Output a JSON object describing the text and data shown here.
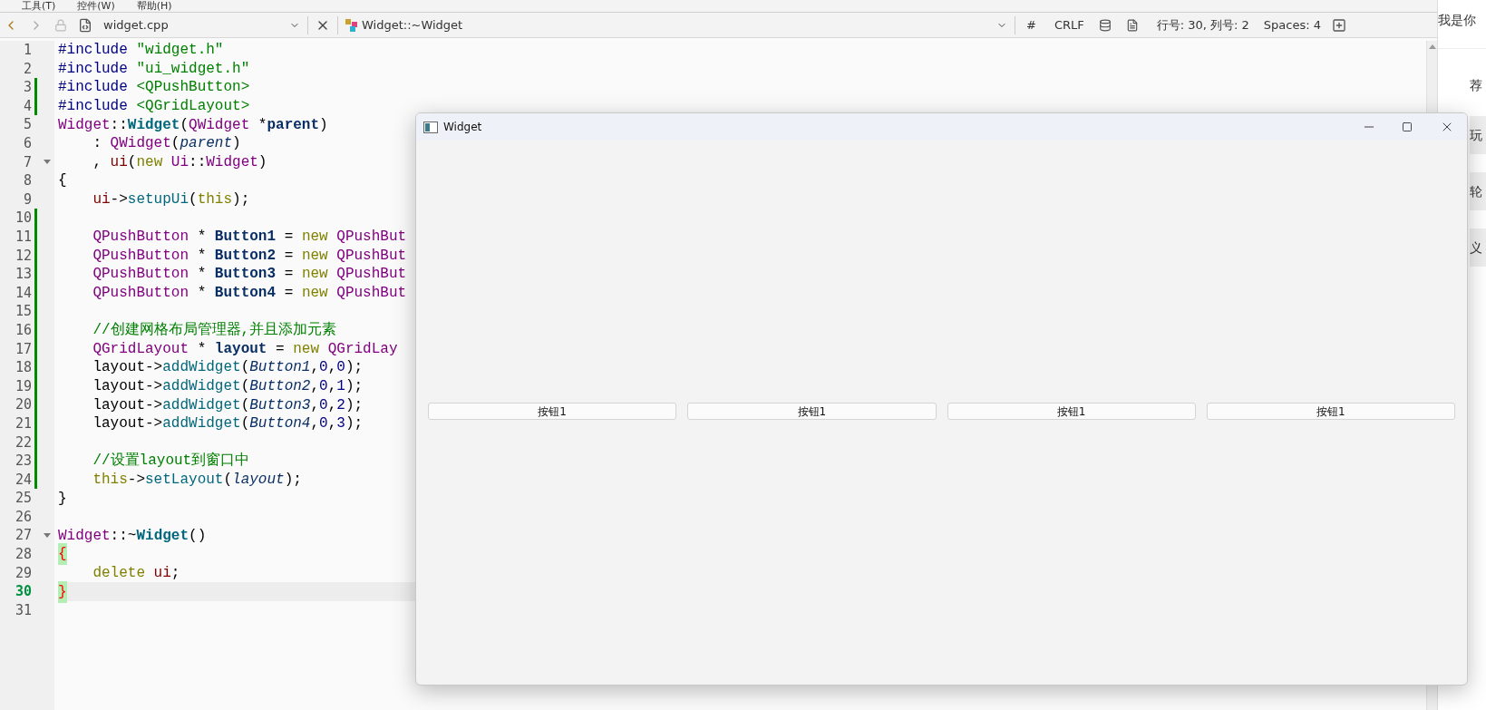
{
  "menu_bar": [
    "工具(T)",
    "控件(W)",
    "帮助(H)"
  ],
  "toolbar": {
    "file_name": "widget.cpp",
    "symbol": "Widget::~Widget",
    "hash": "#",
    "line_ending": "CRLF",
    "position": "行号: 30, 列号: 2",
    "indent": "Spaces: 4"
  },
  "code_lines": [
    {
      "number": "1",
      "changed": false,
      "fold": false,
      "current": false,
      "tokens": [
        {
          "text": "#include ",
          "kind": "preproc"
        },
        {
          "text": "\"widget.h\"",
          "kind": "string"
        }
      ]
    },
    {
      "number": "2",
      "changed": false,
      "fold": false,
      "current": false,
      "tokens": [
        {
          "text": "#include ",
          "kind": "preproc"
        },
        {
          "text": "\"ui_widget.h\"",
          "kind": "string"
        }
      ]
    },
    {
      "number": "3",
      "changed": true,
      "fold": false,
      "current": false,
      "tokens": [
        {
          "text": "#include ",
          "kind": "preproc"
        },
        {
          "text": "<QPushButton>",
          "kind": "string"
        }
      ]
    },
    {
      "number": "4",
      "changed": true,
      "fold": false,
      "current": false,
      "tokens": [
        {
          "text": "#include ",
          "kind": "preproc"
        },
        {
          "text": "<QGridLayout>",
          "kind": "string"
        }
      ]
    },
    {
      "number": "5",
      "changed": false,
      "fold": false,
      "current": false,
      "tokens": [
        {
          "text": "Widget",
          "kind": "type"
        },
        {
          "text": "::",
          "kind": "plain"
        },
        {
          "text": "Widget",
          "kind": "func_def"
        },
        {
          "text": "(",
          "kind": "plain"
        },
        {
          "text": "QWidget",
          "kind": "type"
        },
        {
          "text": " *",
          "kind": "plain"
        },
        {
          "text": "parent",
          "kind": "bold"
        },
        {
          "text": ")",
          "kind": "plain"
        }
      ]
    },
    {
      "number": "6",
      "changed": false,
      "fold": false,
      "current": false,
      "tokens": [
        {
          "text": "    : ",
          "kind": "plain"
        },
        {
          "text": "QWidget",
          "kind": "type"
        },
        {
          "text": "(",
          "kind": "plain"
        },
        {
          "text": "parent",
          "kind": "param"
        },
        {
          "text": ")",
          "kind": "plain"
        }
      ]
    },
    {
      "number": "7",
      "changed": false,
      "fold": true,
      "current": false,
      "tokens": [
        {
          "text": "    , ",
          "kind": "plain"
        },
        {
          "text": "ui",
          "kind": "member"
        },
        {
          "text": "(",
          "kind": "plain"
        },
        {
          "text": "new",
          "kind": "keyword"
        },
        {
          "text": " Ui",
          "kind": "type"
        },
        {
          "text": "::",
          "kind": "plain"
        },
        {
          "text": "Widget",
          "kind": "type"
        },
        {
          "text": ")",
          "kind": "plain"
        }
      ]
    },
    {
      "number": "8",
      "changed": false,
      "fold": false,
      "current": false,
      "tokens": [
        {
          "text": "{",
          "kind": "plain"
        }
      ]
    },
    {
      "number": "9",
      "changed": false,
      "fold": false,
      "current": false,
      "tokens": [
        {
          "text": "    ui",
          "kind": "member"
        },
        {
          "text": "->",
          "kind": "plain"
        },
        {
          "text": "setupUi",
          "kind": "func"
        },
        {
          "text": "(",
          "kind": "plain"
        },
        {
          "text": "this",
          "kind": "keyword"
        },
        {
          "text": ");",
          "kind": "plain"
        }
      ]
    },
    {
      "number": "10",
      "changed": true,
      "fold": false,
      "current": false
    },
    {
      "number": "11",
      "changed": true,
      "fold": false,
      "current": false,
      "tokens": [
        {
          "text": "    QPushButton",
          "kind": "type"
        },
        {
          "text": " * ",
          "kind": "plain"
        },
        {
          "text": "Button1",
          "kind": "bold"
        },
        {
          "text": " = ",
          "kind": "plain"
        },
        {
          "text": "new",
          "kind": "keyword"
        },
        {
          "text": " QPushBut",
          "kind": "type"
        }
      ]
    },
    {
      "number": "12",
      "changed": true,
      "fold": false,
      "current": false,
      "tokens": [
        {
          "text": "    QPushButton",
          "kind": "type"
        },
        {
          "text": " * ",
          "kind": "plain"
        },
        {
          "text": "Button2",
          "kind": "bold"
        },
        {
          "text": " = ",
          "kind": "plain"
        },
        {
          "text": "new",
          "kind": "keyword"
        },
        {
          "text": " QPushBut",
          "kind": "type"
        }
      ]
    },
    {
      "number": "13",
      "changed": true,
      "fold": false,
      "current": false,
      "tokens": [
        {
          "text": "    QPushButton",
          "kind": "type"
        },
        {
          "text": " * ",
          "kind": "plain"
        },
        {
          "text": "Button3",
          "kind": "bold"
        },
        {
          "text": " = ",
          "kind": "plain"
        },
        {
          "text": "new",
          "kind": "keyword"
        },
        {
          "text": " QPushBut",
          "kind": "type"
        }
      ]
    },
    {
      "number": "14",
      "changed": true,
      "fold": false,
      "current": false,
      "tokens": [
        {
          "text": "    QPushButton",
          "kind": "type"
        },
        {
          "text": " * ",
          "kind": "plain"
        },
        {
          "text": "Button4",
          "kind": "bold"
        },
        {
          "text": " = ",
          "kind": "plain"
        },
        {
          "text": "new",
          "kind": "keyword"
        },
        {
          "text": " QPushBut",
          "kind": "type"
        }
      ]
    },
    {
      "number": "15",
      "changed": true,
      "fold": false,
      "current": false
    },
    {
      "number": "16",
      "changed": true,
      "fold": false,
      "current": false,
      "tokens": [
        {
          "text": "    //创建网格布局管理器,并且添加元素",
          "kind": "comment"
        }
      ]
    },
    {
      "number": "17",
      "changed": true,
      "fold": false,
      "current": false,
      "tokens": [
        {
          "text": "    QGridLayout",
          "kind": "type"
        },
        {
          "text": " * ",
          "kind": "plain"
        },
        {
          "text": "layout",
          "kind": "bold"
        },
        {
          "text": " = ",
          "kind": "plain"
        },
        {
          "text": "new",
          "kind": "keyword"
        },
        {
          "text": " QGridLay",
          "kind": "type"
        }
      ]
    },
    {
      "number": "18",
      "changed": true,
      "fold": false,
      "current": false,
      "tokens": [
        {
          "text": "    layout->",
          "kind": "plain"
        },
        {
          "text": "addWidget",
          "kind": "func"
        },
        {
          "text": "(",
          "kind": "plain"
        },
        {
          "text": "Button1",
          "kind": "param"
        },
        {
          "text": ",",
          "kind": "plain"
        },
        {
          "text": "0",
          "kind": "number"
        },
        {
          "text": ",",
          "kind": "plain"
        },
        {
          "text": "0",
          "kind": "number"
        },
        {
          "text": ");",
          "kind": "plain"
        }
      ]
    },
    {
      "number": "19",
      "changed": true,
      "fold": false,
      "current": false,
      "tokens": [
        {
          "text": "    layout->",
          "kind": "plain"
        },
        {
          "text": "addWidget",
          "kind": "func"
        },
        {
          "text": "(",
          "kind": "plain"
        },
        {
          "text": "Button2",
          "kind": "param"
        },
        {
          "text": ",",
          "kind": "plain"
        },
        {
          "text": "0",
          "kind": "number"
        },
        {
          "text": ",",
          "kind": "plain"
        },
        {
          "text": "1",
          "kind": "number"
        },
        {
          "text": ");",
          "kind": "plain"
        }
      ]
    },
    {
      "number": "20",
      "changed": true,
      "fold": false,
      "current": false,
      "tokens": [
        {
          "text": "    layout->",
          "kind": "plain"
        },
        {
          "text": "addWidget",
          "kind": "func"
        },
        {
          "text": "(",
          "kind": "plain"
        },
        {
          "text": "Button3",
          "kind": "param"
        },
        {
          "text": ",",
          "kind": "plain"
        },
        {
          "text": "0",
          "kind": "number"
        },
        {
          "text": ",",
          "kind": "plain"
        },
        {
          "text": "2",
          "kind": "number"
        },
        {
          "text": ");",
          "kind": "plain"
        }
      ]
    },
    {
      "number": "21",
      "changed": true,
      "fold": false,
      "current": false,
      "tokens": [
        {
          "text": "    layout->",
          "kind": "plain"
        },
        {
          "text": "addWidget",
          "kind": "func"
        },
        {
          "text": "(",
          "kind": "plain"
        },
        {
          "text": "Button4",
          "kind": "param"
        },
        {
          "text": ",",
          "kind": "plain"
        },
        {
          "text": "0",
          "kind": "number"
        },
        {
          "text": ",",
          "kind": "plain"
        },
        {
          "text": "3",
          "kind": "number"
        },
        {
          "text": ");",
          "kind": "plain"
        }
      ]
    },
    {
      "number": "22",
      "changed": true,
      "fold": false,
      "current": false
    },
    {
      "number": "23",
      "changed": true,
      "fold": false,
      "current": false,
      "tokens": [
        {
          "text": "    //设置layout到窗口中",
          "kind": "comment"
        }
      ]
    },
    {
      "number": "24",
      "changed": true,
      "fold": false,
      "current": false,
      "tokens": [
        {
          "text": "    this",
          "kind": "keyword"
        },
        {
          "text": "->",
          "kind": "plain"
        },
        {
          "text": "setLayout",
          "kind": "func"
        },
        {
          "text": "(",
          "kind": "plain"
        },
        {
          "text": "layout",
          "kind": "param"
        },
        {
          "text": ");",
          "kind": "plain"
        }
      ]
    },
    {
      "number": "25",
      "changed": false,
      "fold": false,
      "current": false,
      "tokens": [
        {
          "text": "}",
          "kind": "plain"
        }
      ]
    },
    {
      "number": "26",
      "changed": false,
      "fold": false,
      "current": false
    },
    {
      "number": "27",
      "changed": false,
      "fold": true,
      "current": false,
      "tokens": [
        {
          "text": "Widget",
          "kind": "type"
        },
        {
          "text": "::~",
          "kind": "plain"
        },
        {
          "text": "Widget",
          "kind": "func_def"
        },
        {
          "text": "()",
          "kind": "plain"
        }
      ]
    },
    {
      "number": "28",
      "changed": false,
      "fold": false,
      "current": false,
      "tokens": [
        {
          "text": "{",
          "kind": "brace_match"
        }
      ]
    },
    {
      "number": "29",
      "changed": false,
      "fold": false,
      "current": false,
      "tokens": [
        {
          "text": "    delete",
          "kind": "keyword"
        },
        {
          "text": " ui",
          "kind": "member"
        },
        {
          "text": ";",
          "kind": "plain"
        }
      ]
    },
    {
      "number": "30",
      "changed": false,
      "fold": false,
      "current": true,
      "tokens": [
        {
          "text": "}",
          "kind": "brace_match"
        }
      ]
    },
    {
      "number": "31",
      "changed": false,
      "fold": false,
      "current": false
    }
  ],
  "side_panel": {
    "heading": "我是你",
    "items": [
      "荐",
      "玩",
      "轮",
      "义"
    ]
  },
  "widget_window": {
    "title": "Widget",
    "buttons": [
      {
        "label": "按钮1"
      },
      {
        "label": "按钮1"
      },
      {
        "label": "按钮1"
      },
      {
        "label": "按钮1"
      }
    ]
  }
}
